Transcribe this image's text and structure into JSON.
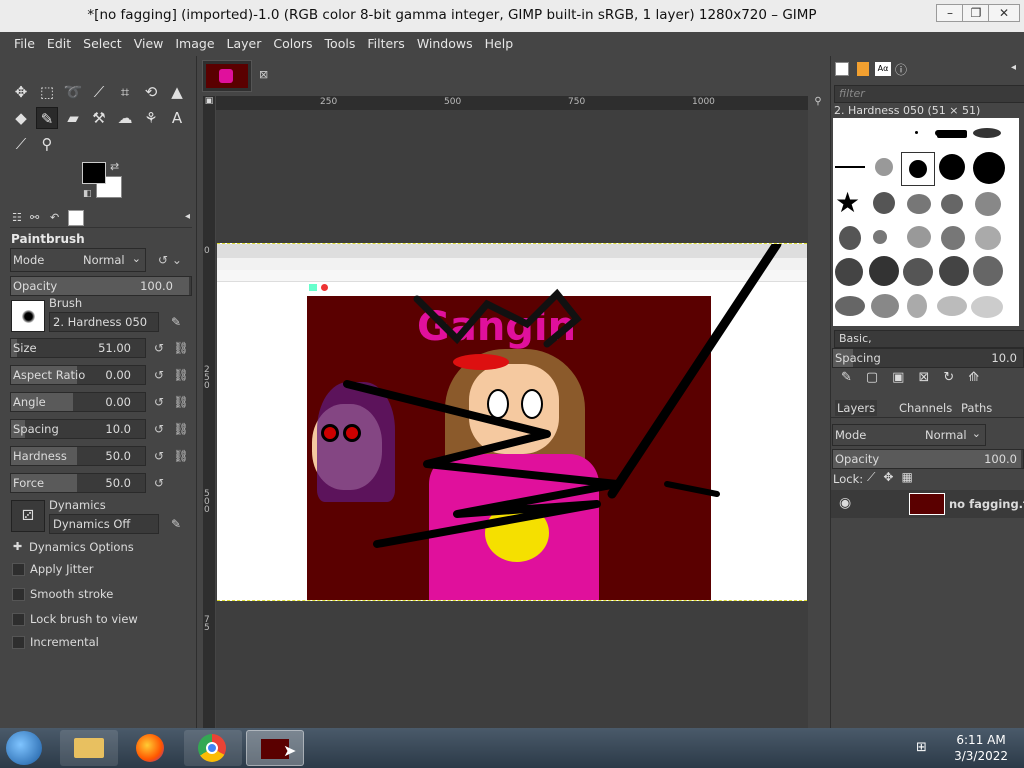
{
  "window": {
    "title": "*[no fagging] (imported)-1.0 (RGB color 8-bit gamma integer, GIMP built-in sRGB, 1 layer) 1280x720 – GIMP",
    "minimize": "–",
    "maximize": "❐",
    "close": "✕"
  },
  "menubar": [
    "File",
    "Edit",
    "Select",
    "View",
    "Image",
    "Layer",
    "Colors",
    "Tools",
    "Filters",
    "Windows",
    "Help"
  ],
  "tool_options": {
    "title": "Paintbrush",
    "mode_label": "Mode",
    "mode_value": "Normal",
    "opacity_label": "Opacity",
    "opacity_value": "100.0",
    "brush_label": "Brush",
    "brush_value": "2. Hardness 050",
    "sliders": [
      {
        "label": "Size",
        "value": "51.00",
        "fraction": 0.05
      },
      {
        "label": "Aspect Ratio",
        "value": "0.00",
        "fraction": 0.5
      },
      {
        "label": "Angle",
        "value": "0.00",
        "fraction": 0.5
      },
      {
        "label": "Spacing",
        "value": "10.0",
        "fraction": 0.1
      },
      {
        "label": "Hardness",
        "value": "50.0",
        "fraction": 0.5
      },
      {
        "label": "Force",
        "value": "50.0",
        "fraction": 0.5
      }
    ],
    "dynamics_label": "Dynamics",
    "dynamics_value": "Dynamics Off",
    "dynamics_options": "Dynamics Options",
    "checkboxes": [
      "Apply Jitter",
      "Smooth stroke",
      "Lock brush to view",
      "Incremental"
    ]
  },
  "rulers": {
    "top": [
      "250",
      "500",
      "750",
      "1000"
    ],
    "left": [
      "0",
      "2 5 0",
      "5 0 0",
      "7 5"
    ]
  },
  "brushes_panel": {
    "filter_placeholder": "filter",
    "selected": "2. Hardness 050 (51 × 51)",
    "preset": "Basic,",
    "spacing_label": "Spacing",
    "spacing_value": "10.0"
  },
  "layers_panel": {
    "tabs": [
      "Layers",
      "Channels",
      "Paths"
    ],
    "mode_label": "Mode",
    "mode_value": "Normal",
    "opacity_label": "Opacity",
    "opacity_value": "100.0",
    "lock_label": "Lock:",
    "layer_name": "no fagging.tga"
  },
  "image_content": {
    "text": "Gangin"
  },
  "taskbar": {
    "time": "6:11 AM",
    "date": "3/3/2022"
  },
  "colors": {
    "fg": "#000000",
    "bg": "#ffffff",
    "canvas_dark_red": "#5a0000",
    "pink": "#e0109c"
  }
}
